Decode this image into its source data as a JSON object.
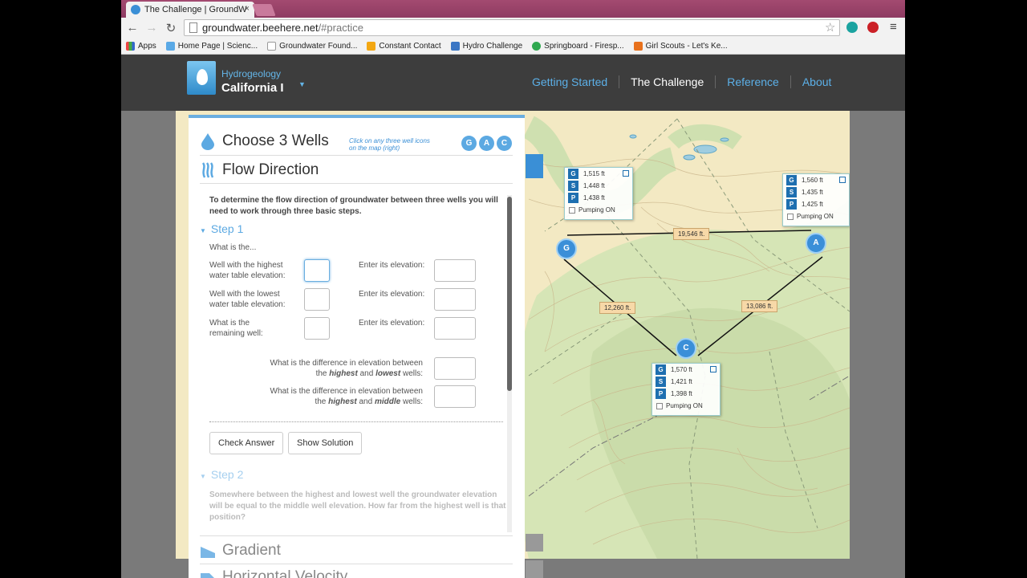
{
  "browser": {
    "tab_title": "The Challenge | GroundW",
    "tab_close": "×",
    "url_domain": "groundwater.beehere.net",
    "url_path": "/#practice",
    "bookmarks": [
      "Apps",
      "Home Page | Scienc...",
      "Groundwater Found...",
      "Constant Contact",
      "Hydro Challenge",
      "Springboard - Firesp...",
      "Girl Scouts - Let's Ke..."
    ]
  },
  "site": {
    "brand_small": "Hydrogeology",
    "brand_big": "California I",
    "nav": [
      "Getting Started",
      "The Challenge",
      "Reference",
      "About"
    ],
    "nav_active": "The Challenge"
  },
  "panel": {
    "choose_title": "Choose 3 Wells",
    "choose_hint": "Click on any three well icons on the map (right)",
    "well_buttons": [
      "G",
      "A",
      "C"
    ],
    "flow_title": "Flow Direction",
    "intro": "To determine the flow direction of groundwater between three wells you will need to work through three basic steps.",
    "step1": "Step 1",
    "step1_prompt": "What is the...",
    "q_highest": "Well with the highest water table elevation:",
    "q_lowest": "Well with the lowest water table elevation:",
    "q_remaining": "What is the remaining well:",
    "enter_elev": "Enter its elevation:",
    "diff_hl_a": "What is the difference in elevation between",
    "diff_hl_b1": "the",
    "diff_hl_b2": "highest",
    "diff_hl_b3": "and",
    "diff_hl_b4": "lowest",
    "diff_hl_b5": "wells:",
    "diff_hm_a": "What is the difference in elevation between",
    "diff_hm_b1": "the",
    "diff_hm_b2": "highest",
    "diff_hm_b3": "and",
    "diff_hm_b4": "middle",
    "diff_hm_b5": "wells:",
    "check_answer": "Check Answer",
    "show_solution": "Show Solution",
    "step2": "Step 2",
    "step2_text": "Somewhere between the highest and lowest well the groundwater elevation will be equal to the middle well elevation. How far from the highest well is that position?",
    "gradient_title": "Gradient",
    "velocity_title": "Horizontal Velocity"
  },
  "map": {
    "wells": [
      {
        "id": "G",
        "rows": [
          [
            "G",
            "1,515 ft"
          ],
          [
            "S",
            "1,448 ft"
          ],
          [
            "P",
            "1,438 ft"
          ]
        ],
        "pump": "Pumping ON"
      },
      {
        "id": "A",
        "rows": [
          [
            "G",
            "1,560 ft"
          ],
          [
            "S",
            "1,435 ft"
          ],
          [
            "P",
            "1,425 ft"
          ]
        ],
        "pump": "Pumping ON"
      },
      {
        "id": "C",
        "rows": [
          [
            "G",
            "1,570 ft"
          ],
          [
            "S",
            "1,421 ft"
          ],
          [
            "P",
            "1,398 ft"
          ]
        ],
        "pump": "Pumping ON"
      }
    ],
    "distances": [
      "19,546 ft.",
      "12,260 ft.",
      "13,086 ft."
    ],
    "colors": {
      "land": "#f3e9c3",
      "green": "#cfe0b0",
      "lake": "#7ab8d6",
      "contour": "#c9b48a"
    }
  }
}
